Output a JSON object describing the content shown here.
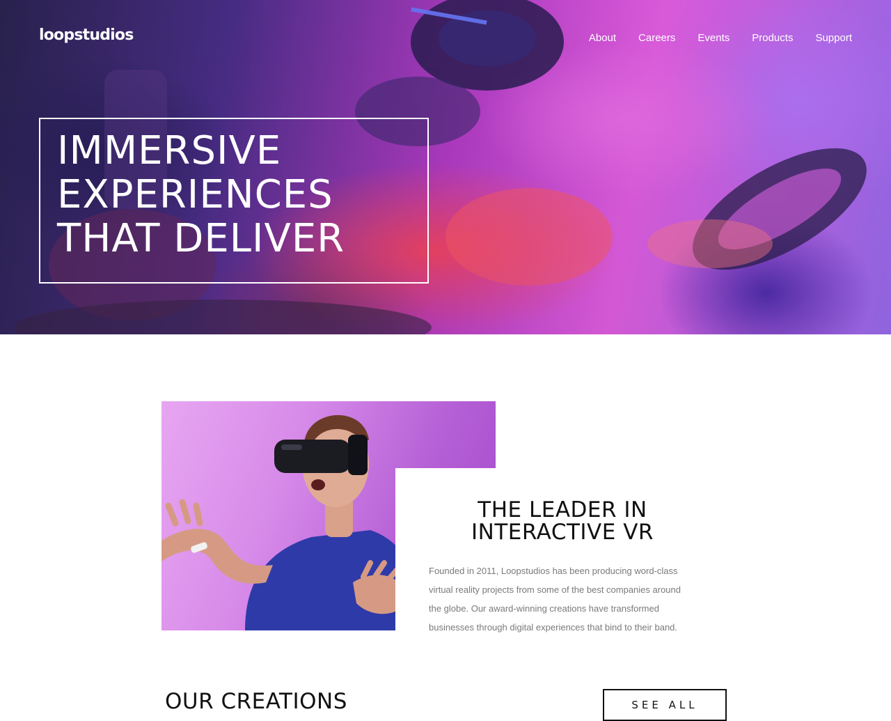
{
  "header": {
    "logo": "loopstudios",
    "nav": [
      {
        "label": "About"
      },
      {
        "label": "Careers"
      },
      {
        "label": "Events"
      },
      {
        "label": "Products"
      },
      {
        "label": "Support"
      }
    ]
  },
  "hero": {
    "title_lines": [
      "IMMERSIVE",
      "EXPERIENCES",
      "THAT DELIVER"
    ]
  },
  "interactive": {
    "heading_lines": [
      "THE LEADER IN",
      "INTERACTIVE VR"
    ],
    "body": "Founded in 2011, Loopstudios has been producing word-class virtual reality projects from some of the best companies around the globe. Our award-winning creations have transformed businesses through digital experiences that bind to their band."
  },
  "creations": {
    "title": "OUR CREATIONS",
    "see_all_label": "SEE ALL"
  },
  "colors": {
    "hero_magenta": "#e45fe5",
    "hero_red": "#ff4655",
    "hero_indigo": "#2a2350",
    "vr_purple": "#b560d6",
    "text_dark": "#111111",
    "text_muted": "#7a7a7a"
  }
}
